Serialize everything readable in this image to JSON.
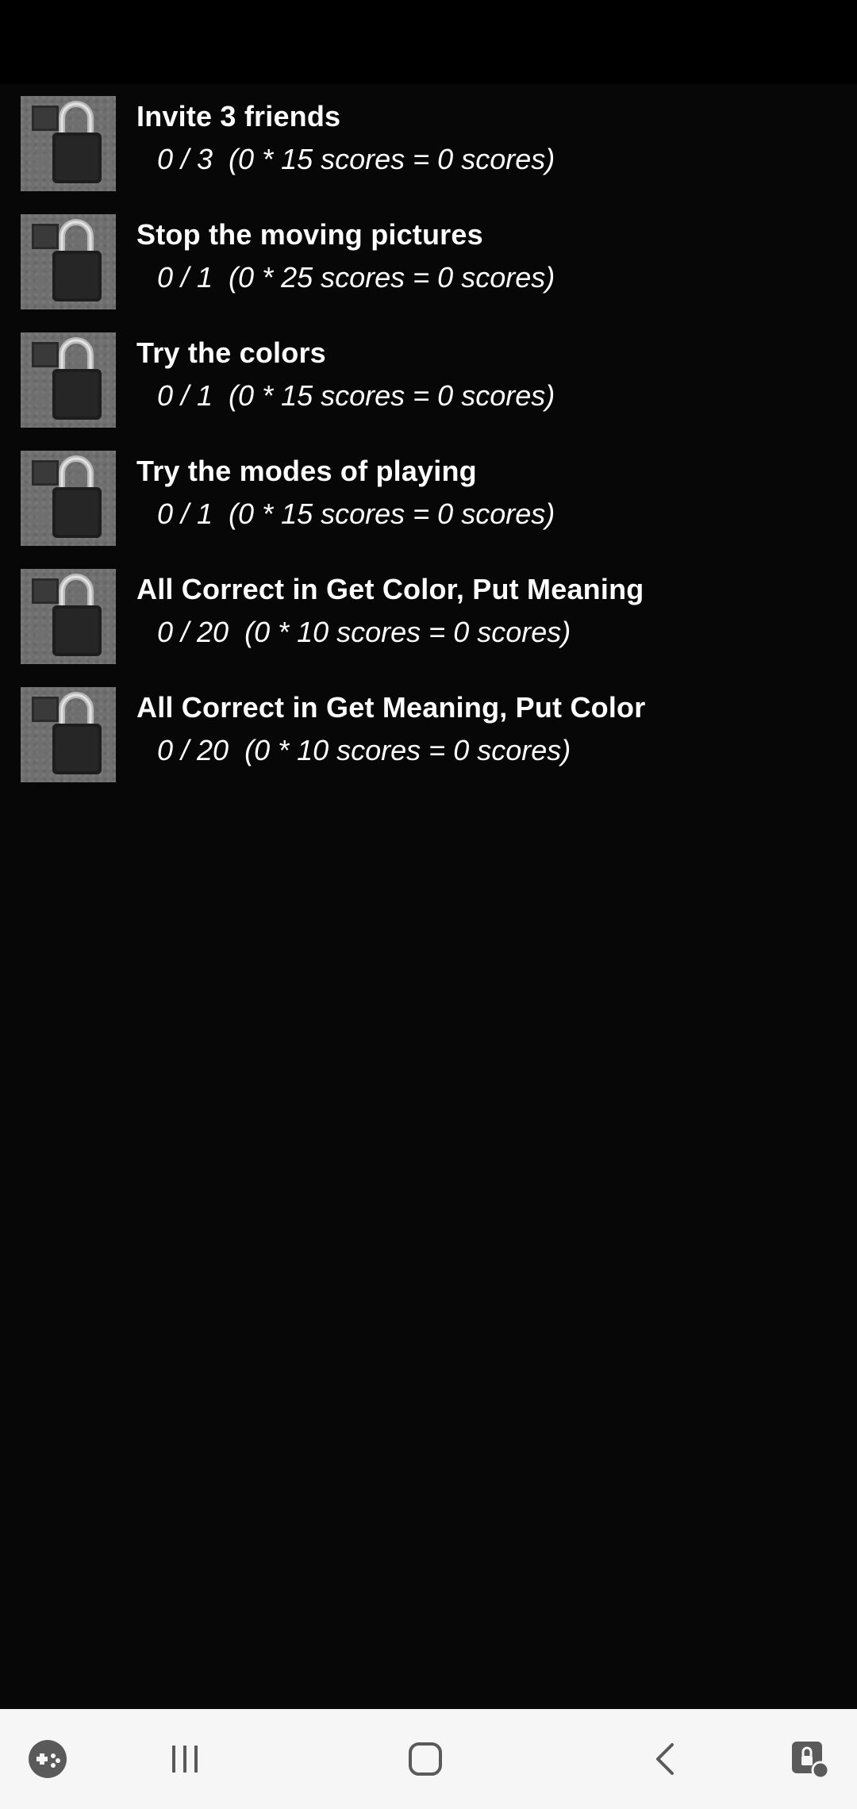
{
  "achievements": [
    {
      "title": "Invite 3 friends",
      "progress": "0 / 3  (0 * 15 scores = 0 scores)",
      "icon": "padlock-icon"
    },
    {
      "title": "Stop the moving pictures",
      "progress": "0 / 1  (0 * 25 scores = 0 scores)",
      "icon": "padlock-icon"
    },
    {
      "title": "Try the colors",
      "progress": "0 / 1  (0 * 15 scores = 0 scores)",
      "icon": "padlock-icon"
    },
    {
      "title": "Try the modes of playing",
      "progress": "0 / 1  (0 * 15 scores = 0 scores)",
      "icon": "padlock-icon"
    },
    {
      "title": "All Correct in Get Color, Put Meaning",
      "progress": "0 / 20  (0 * 10 scores = 0 scores)",
      "icon": "padlock-icon"
    },
    {
      "title": "All Correct in Get Meaning, Put Color",
      "progress": "0 / 20  (0 * 10 scores = 0 scores)",
      "icon": "padlock-icon"
    }
  ],
  "nav_bar": {
    "icons": [
      "game-launcher-icon",
      "recent-apps-icon",
      "home-icon",
      "back-icon",
      "screen-lock-icon"
    ]
  },
  "colors": {
    "background": "#070707",
    "text": "#ffffff",
    "nav_bar": "#f6f6f6",
    "nav_icon": "#5a5a5a"
  }
}
